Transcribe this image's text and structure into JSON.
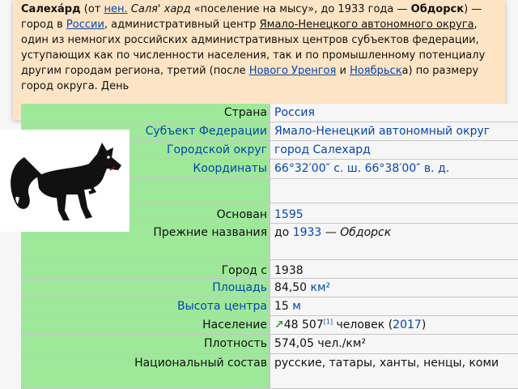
{
  "article": {
    "title": "Салеха́рд",
    "paren_open": " (от ",
    "lang_link": "нен.",
    "etym_word": " Саля' хард",
    "etym_meaning": " «поселение на мысу», до 1933 года — ",
    "old_name": "Обдорск",
    "t1": ") — город в ",
    "link_russia": "России",
    "t2": ", административный центр ",
    "link_okrug": "Ямало-Ненецкого автономного округа",
    "t3": ", один из немногих российских административных центров субъектов федерации, уступающих как по численности населения, так и по промышленному потенциалу другим городам региона, третий (после ",
    "link_novy": "Нового Уренгоя",
    "t4": " и ",
    "link_noyabrsk": "Ноябрьск",
    "t5": "а) по размеру город округа. День"
  },
  "infobox": {
    "rows": [
      {
        "label": "Страна",
        "value": "Россия"
      },
      {
        "label": "Субъект Федерации",
        "value": "Ямало-Ненецкий автономный округ"
      },
      {
        "label": "Городской округ",
        "value": "город Салехард"
      },
      {
        "label": "Координаты",
        "value": "66°32′00″ с. ш. 66°38′00″ в. д."
      },
      {
        "label": "",
        "value": ""
      },
      {
        "label": "Основан",
        "value": "1595"
      },
      {
        "label": "Прежние названия",
        "value_pre": "до ",
        "value_link": "1933",
        "value_post": " — ",
        "value_italic": "Обдорск"
      },
      {
        "label": "Город с",
        "value": "1938"
      },
      {
        "label": "Площадь",
        "value_pre": "84,50 ",
        "value_link": "км²"
      },
      {
        "label": "Высота центра",
        "value_pre": "15 ",
        "value_link": "м"
      },
      {
        "label": "Население",
        "arrow": "↗",
        "value_pre": "48 507",
        "ref": "[1]",
        "value_mid": " человек (",
        "value_link": "2017",
        "value_post": ")"
      },
      {
        "label": "Плотность",
        "value": "574,05 чел./км²"
      },
      {
        "label": "Национальный состав",
        "value": "русские, татары, ханты, ненцы, коми"
      }
    ]
  },
  "colors": {
    "label_bg": "#9ee89a",
    "article_bg": "#fde4c4",
    "link": "#0645ad"
  },
  "emblem": {
    "icon": "black-fox-emblem-icon"
  }
}
